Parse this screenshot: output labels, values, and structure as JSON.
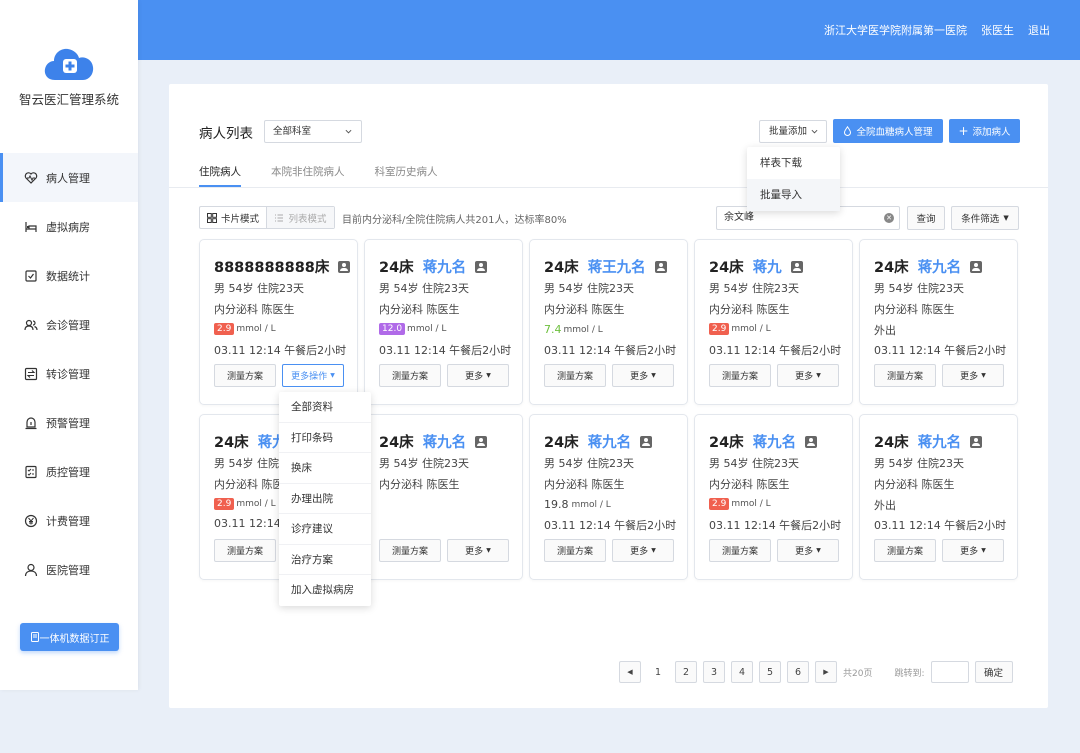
{
  "topbar": {
    "hospital": "浙江大学医学院附属第一医院",
    "user": "张医生",
    "logout": "退出"
  },
  "sidebar": {
    "app_name": "智云医汇管理系统",
    "items": [
      {
        "label": "病人管理",
        "icon": "heart-pulse-icon",
        "active": true
      },
      {
        "label": "虚拟病房",
        "icon": "bed-icon",
        "active": false
      },
      {
        "label": "数据统计",
        "icon": "chart-box-icon",
        "active": false
      },
      {
        "label": "会诊管理",
        "icon": "users-icon",
        "active": false
      },
      {
        "label": "转诊管理",
        "icon": "transfer-icon",
        "active": false
      },
      {
        "label": "预警管理",
        "icon": "alarm-icon",
        "active": false
      },
      {
        "label": "质控管理",
        "icon": "checklist-icon",
        "active": false
      },
      {
        "label": "计费管理",
        "icon": "yen-icon",
        "active": false
      },
      {
        "label": "医院管理",
        "icon": "user-icon",
        "active": false
      }
    ],
    "bottom_button": "一体机数据订正"
  },
  "header": {
    "title": "病人列表",
    "dept_select": "全部科室",
    "batch_add": "批量添加",
    "glucose_manage": "全院血糖病人管理",
    "add_patient": "添加病人"
  },
  "batch_menu": [
    "样表下载",
    "批量导入"
  ],
  "tabs": [
    "住院病人",
    "本院非住院病人",
    "科室历史病人"
  ],
  "toolbar": {
    "card_mode": "卡片模式",
    "list_mode": "列表模式",
    "summary": "目前内分泌科/全院住院病人共201人，达标率80%",
    "search_value": "余文峰",
    "query": "查询",
    "filter": "条件筛选"
  },
  "cards": [
    {
      "bed": "8888888888床",
      "name": "",
      "info": "男  54岁  住院23天",
      "dept": "内分泌科  陈医生",
      "glu_value": "2.9",
      "glu_tag": "red",
      "glu_unit": "mmol / L",
      "time": "03.11 12:14   午餐后2小时",
      "btn1": "测量方案",
      "btn2": "更多操作"
    },
    {
      "bed": "24床",
      "name": "蒋九名",
      "info": "男  54岁  住院23天",
      "dept": "内分泌科  陈医生",
      "glu_value": "12.0",
      "glu_tag": "purple",
      "glu_unit": "mmol / L",
      "time": "03.11 12:14   午餐后2小时",
      "btn1": "测量方案",
      "btn2": "更多"
    },
    {
      "bed": "24床",
      "name": "蒋王九名",
      "info": "男  54岁  住院23天",
      "dept": "内分泌科  陈医生",
      "glu_value": "7.4",
      "glu_tag": "green-text",
      "glu_unit": "mmol / L",
      "time": "03.11 12:14   午餐后2小时",
      "btn1": "测量方案",
      "btn2": "更多"
    },
    {
      "bed": "24床",
      "name": "蒋九",
      "info": "男  54岁  住院23天",
      "dept": "内分泌科  陈医生",
      "glu_value": "2.9",
      "glu_tag": "red",
      "glu_unit": "mmol / L",
      "time": "03.11 12:14   午餐后2小时",
      "btn1": "测量方案",
      "btn2": "更多"
    },
    {
      "bed": "24床",
      "name": "蒋九名",
      "info": "男  54岁  住院23天",
      "dept": "内分泌科  陈医生",
      "glu_value": "",
      "glu_tag": "text",
      "glu_unit": "外出",
      "time": "03.11 12:14   午餐后2小时",
      "btn1": "测量方案",
      "btn2": "更多"
    },
    {
      "bed": "24床",
      "name": "蒋九",
      "info": "男  54岁  住院",
      "dept": "内分泌科  陈医",
      "glu_value": "2.9",
      "glu_tag": "red",
      "glu_unit": "mmol / L",
      "time": "03.11 12:14",
      "btn1": "测量方案",
      "btn2": ""
    },
    {
      "bed": "24床",
      "name": "蒋九名",
      "info": "男  54岁  住院23天",
      "dept": "内分泌科  陈医生",
      "glu_value": "",
      "glu_tag": "none",
      "glu_unit": "",
      "time": "",
      "btn1": "测量方案",
      "btn2": "更多"
    },
    {
      "bed": "24床",
      "name": "蒋九名",
      "info": "男  54岁  住院23天",
      "dept": "内分泌科  陈医生",
      "glu_value": "19.8",
      "glu_tag": "plain",
      "glu_unit": "mmol / L",
      "time": "03.11 12:14   午餐后2小时",
      "btn1": "测量方案",
      "btn2": "更多"
    },
    {
      "bed": "24床",
      "name": "蒋九名",
      "info": "男  54岁  住院23天",
      "dept": "内分泌科  陈医生",
      "glu_value": "2.9",
      "glu_tag": "red",
      "glu_unit": "mmol / L",
      "time": "03.11 12:14   午餐后2小时",
      "btn1": "测量方案",
      "btn2": "更多"
    },
    {
      "bed": "24床",
      "name": "蒋九名",
      "info": "男  54岁  住院23天",
      "dept": "内分泌科  陈医生",
      "glu_value": "",
      "glu_tag": "text",
      "glu_unit": "外出",
      "time": "03.11 12:14   午餐后2小时",
      "btn1": "测量方案",
      "btn2": "更多"
    }
  ],
  "more_menu": [
    "全部资料",
    "打印条码",
    "换床",
    "办理出院",
    "诊疗建议",
    "治疗方案",
    "加入虚拟病房"
  ],
  "pager": {
    "pages": [
      "1",
      "2",
      "3",
      "4",
      "5",
      "6"
    ],
    "current": "1",
    "total": "共20页",
    "goto_label": "跳转到:",
    "confirm": "确定"
  },
  "colors": {
    "primary": "#4a90f2",
    "red": "#f0604f",
    "purple": "#b06ae8",
    "green": "#6cbf3c"
  }
}
